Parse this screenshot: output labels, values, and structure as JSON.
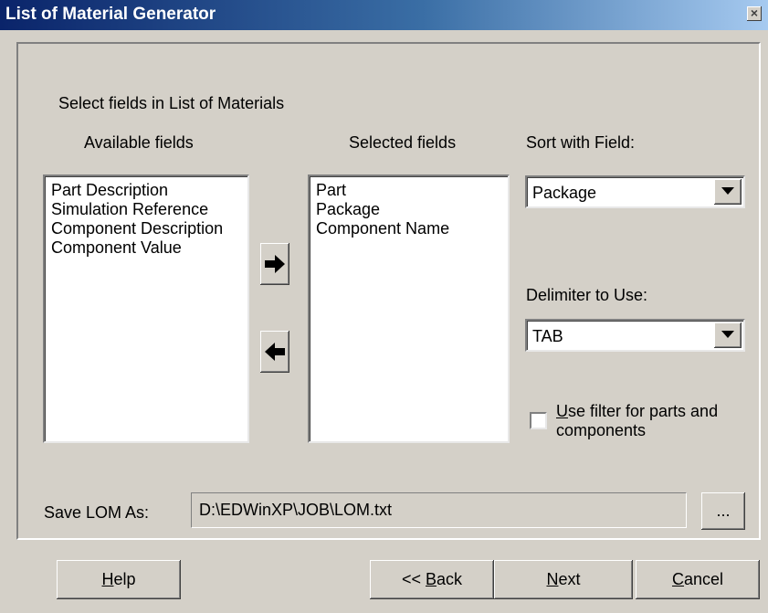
{
  "window": {
    "title": "List of Material Generator",
    "close_glyph": "×"
  },
  "labels": {
    "select_fields": "Select fields in  List of Materials",
    "available_fields": "Available fields",
    "selected_fields": "Selected fields",
    "sort_with_field": "Sort with Field:",
    "delimiter": "Delimiter to Use:",
    "use_filter_key": "U",
    "use_filter_rest": "se filter for parts and",
    "use_filter_line2": "components",
    "save_lom_as": "Save LOM As:"
  },
  "available_fields": [
    "Part Description",
    "Simulation Reference",
    "Component Description",
    "Component Value"
  ],
  "selected_fields": [
    "Part",
    "Package",
    "Component Name"
  ],
  "sort_field": {
    "value": "Package"
  },
  "delimiter": {
    "value": "TAB"
  },
  "use_filter_checked": false,
  "save_path": "D:\\EDWinXP\\JOB\\LOM.txt",
  "browse_label": "...",
  "buttons": {
    "help_key": "H",
    "help_rest": "elp",
    "back_prefix": "<< ",
    "back_key": "B",
    "back_rest": "ack",
    "next_key": "N",
    "next_rest": "ext",
    "cancel_key": "C",
    "cancel_rest": "ancel"
  },
  "icons": {
    "add": "right-arrow-icon",
    "remove": "left-arrow-icon",
    "dropdown": "dropdown-arrow-icon"
  }
}
